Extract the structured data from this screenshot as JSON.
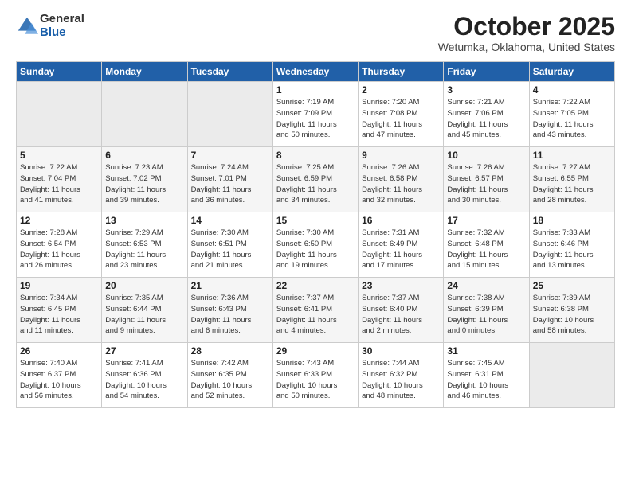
{
  "header": {
    "logo_general": "General",
    "logo_blue": "Blue",
    "month": "October 2025",
    "location": "Wetumka, Oklahoma, United States"
  },
  "weekdays": [
    "Sunday",
    "Monday",
    "Tuesday",
    "Wednesday",
    "Thursday",
    "Friday",
    "Saturday"
  ],
  "weeks": [
    [
      {
        "day": "",
        "info": ""
      },
      {
        "day": "",
        "info": ""
      },
      {
        "day": "",
        "info": ""
      },
      {
        "day": "1",
        "info": "Sunrise: 7:19 AM\nSunset: 7:09 PM\nDaylight: 11 hours\nand 50 minutes."
      },
      {
        "day": "2",
        "info": "Sunrise: 7:20 AM\nSunset: 7:08 PM\nDaylight: 11 hours\nand 47 minutes."
      },
      {
        "day": "3",
        "info": "Sunrise: 7:21 AM\nSunset: 7:06 PM\nDaylight: 11 hours\nand 45 minutes."
      },
      {
        "day": "4",
        "info": "Sunrise: 7:22 AM\nSunset: 7:05 PM\nDaylight: 11 hours\nand 43 minutes."
      }
    ],
    [
      {
        "day": "5",
        "info": "Sunrise: 7:22 AM\nSunset: 7:04 PM\nDaylight: 11 hours\nand 41 minutes."
      },
      {
        "day": "6",
        "info": "Sunrise: 7:23 AM\nSunset: 7:02 PM\nDaylight: 11 hours\nand 39 minutes."
      },
      {
        "day": "7",
        "info": "Sunrise: 7:24 AM\nSunset: 7:01 PM\nDaylight: 11 hours\nand 36 minutes."
      },
      {
        "day": "8",
        "info": "Sunrise: 7:25 AM\nSunset: 6:59 PM\nDaylight: 11 hours\nand 34 minutes."
      },
      {
        "day": "9",
        "info": "Sunrise: 7:26 AM\nSunset: 6:58 PM\nDaylight: 11 hours\nand 32 minutes."
      },
      {
        "day": "10",
        "info": "Sunrise: 7:26 AM\nSunset: 6:57 PM\nDaylight: 11 hours\nand 30 minutes."
      },
      {
        "day": "11",
        "info": "Sunrise: 7:27 AM\nSunset: 6:55 PM\nDaylight: 11 hours\nand 28 minutes."
      }
    ],
    [
      {
        "day": "12",
        "info": "Sunrise: 7:28 AM\nSunset: 6:54 PM\nDaylight: 11 hours\nand 26 minutes."
      },
      {
        "day": "13",
        "info": "Sunrise: 7:29 AM\nSunset: 6:53 PM\nDaylight: 11 hours\nand 23 minutes."
      },
      {
        "day": "14",
        "info": "Sunrise: 7:30 AM\nSunset: 6:51 PM\nDaylight: 11 hours\nand 21 minutes."
      },
      {
        "day": "15",
        "info": "Sunrise: 7:30 AM\nSunset: 6:50 PM\nDaylight: 11 hours\nand 19 minutes."
      },
      {
        "day": "16",
        "info": "Sunrise: 7:31 AM\nSunset: 6:49 PM\nDaylight: 11 hours\nand 17 minutes."
      },
      {
        "day": "17",
        "info": "Sunrise: 7:32 AM\nSunset: 6:48 PM\nDaylight: 11 hours\nand 15 minutes."
      },
      {
        "day": "18",
        "info": "Sunrise: 7:33 AM\nSunset: 6:46 PM\nDaylight: 11 hours\nand 13 minutes."
      }
    ],
    [
      {
        "day": "19",
        "info": "Sunrise: 7:34 AM\nSunset: 6:45 PM\nDaylight: 11 hours\nand 11 minutes."
      },
      {
        "day": "20",
        "info": "Sunrise: 7:35 AM\nSunset: 6:44 PM\nDaylight: 11 hours\nand 9 minutes."
      },
      {
        "day": "21",
        "info": "Sunrise: 7:36 AM\nSunset: 6:43 PM\nDaylight: 11 hours\nand 6 minutes."
      },
      {
        "day": "22",
        "info": "Sunrise: 7:37 AM\nSunset: 6:41 PM\nDaylight: 11 hours\nand 4 minutes."
      },
      {
        "day": "23",
        "info": "Sunrise: 7:37 AM\nSunset: 6:40 PM\nDaylight: 11 hours\nand 2 minutes."
      },
      {
        "day": "24",
        "info": "Sunrise: 7:38 AM\nSunset: 6:39 PM\nDaylight: 11 hours\nand 0 minutes."
      },
      {
        "day": "25",
        "info": "Sunrise: 7:39 AM\nSunset: 6:38 PM\nDaylight: 10 hours\nand 58 minutes."
      }
    ],
    [
      {
        "day": "26",
        "info": "Sunrise: 7:40 AM\nSunset: 6:37 PM\nDaylight: 10 hours\nand 56 minutes."
      },
      {
        "day": "27",
        "info": "Sunrise: 7:41 AM\nSunset: 6:36 PM\nDaylight: 10 hours\nand 54 minutes."
      },
      {
        "day": "28",
        "info": "Sunrise: 7:42 AM\nSunset: 6:35 PM\nDaylight: 10 hours\nand 52 minutes."
      },
      {
        "day": "29",
        "info": "Sunrise: 7:43 AM\nSunset: 6:33 PM\nDaylight: 10 hours\nand 50 minutes."
      },
      {
        "day": "30",
        "info": "Sunrise: 7:44 AM\nSunset: 6:32 PM\nDaylight: 10 hours\nand 48 minutes."
      },
      {
        "day": "31",
        "info": "Sunrise: 7:45 AM\nSunset: 6:31 PM\nDaylight: 10 hours\nand 46 minutes."
      },
      {
        "day": "",
        "info": ""
      }
    ]
  ]
}
